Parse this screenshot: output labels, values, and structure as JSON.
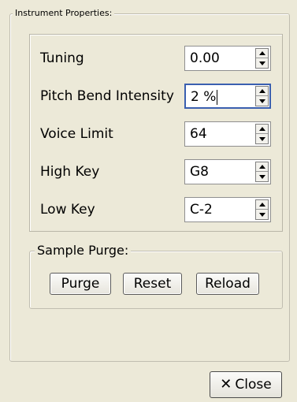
{
  "instrument_properties": {
    "legend": "Instrument Properties:",
    "fields": [
      {
        "label": "Tuning",
        "value": "0.00"
      },
      {
        "label": "Pitch Bend Intensity",
        "value": "2 %"
      },
      {
        "label": "Voice Limit",
        "value": "64"
      },
      {
        "label": "High Key",
        "value": "G8"
      },
      {
        "label": "Low Key",
        "value": "C-2"
      }
    ]
  },
  "sample_purge": {
    "legend": "Sample Purge:",
    "purge_label": "Purge",
    "reset_label": "Reset",
    "reload_label": "Reload"
  },
  "footer": {
    "close_label": "Close",
    "close_icon": "close-x-icon"
  }
}
